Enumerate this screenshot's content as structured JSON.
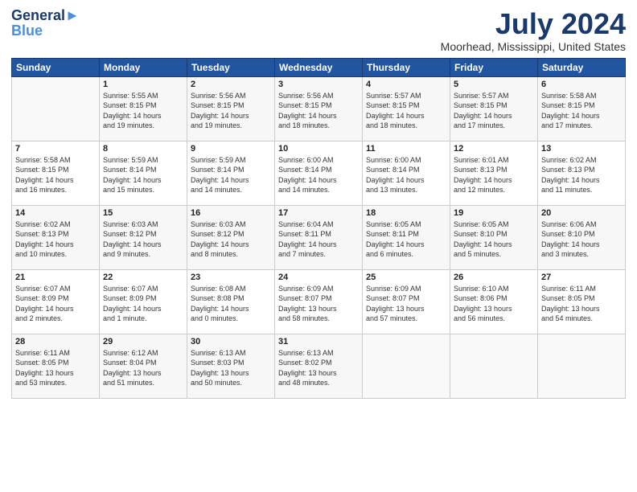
{
  "logo": {
    "line1": "General",
    "line2": "Blue"
  },
  "title": "July 2024",
  "location": "Moorhead, Mississippi, United States",
  "days_of_week": [
    "Sunday",
    "Monday",
    "Tuesday",
    "Wednesday",
    "Thursday",
    "Friday",
    "Saturday"
  ],
  "weeks": [
    [
      {
        "day": "",
        "info": ""
      },
      {
        "day": "1",
        "info": "Sunrise: 5:55 AM\nSunset: 8:15 PM\nDaylight: 14 hours\nand 19 minutes."
      },
      {
        "day": "2",
        "info": "Sunrise: 5:56 AM\nSunset: 8:15 PM\nDaylight: 14 hours\nand 19 minutes."
      },
      {
        "day": "3",
        "info": "Sunrise: 5:56 AM\nSunset: 8:15 PM\nDaylight: 14 hours\nand 18 minutes."
      },
      {
        "day": "4",
        "info": "Sunrise: 5:57 AM\nSunset: 8:15 PM\nDaylight: 14 hours\nand 18 minutes."
      },
      {
        "day": "5",
        "info": "Sunrise: 5:57 AM\nSunset: 8:15 PM\nDaylight: 14 hours\nand 17 minutes."
      },
      {
        "day": "6",
        "info": "Sunrise: 5:58 AM\nSunset: 8:15 PM\nDaylight: 14 hours\nand 17 minutes."
      }
    ],
    [
      {
        "day": "7",
        "info": "Sunrise: 5:58 AM\nSunset: 8:15 PM\nDaylight: 14 hours\nand 16 minutes."
      },
      {
        "day": "8",
        "info": "Sunrise: 5:59 AM\nSunset: 8:14 PM\nDaylight: 14 hours\nand 15 minutes."
      },
      {
        "day": "9",
        "info": "Sunrise: 5:59 AM\nSunset: 8:14 PM\nDaylight: 14 hours\nand 14 minutes."
      },
      {
        "day": "10",
        "info": "Sunrise: 6:00 AM\nSunset: 8:14 PM\nDaylight: 14 hours\nand 14 minutes."
      },
      {
        "day": "11",
        "info": "Sunrise: 6:00 AM\nSunset: 8:14 PM\nDaylight: 14 hours\nand 13 minutes."
      },
      {
        "day": "12",
        "info": "Sunrise: 6:01 AM\nSunset: 8:13 PM\nDaylight: 14 hours\nand 12 minutes."
      },
      {
        "day": "13",
        "info": "Sunrise: 6:02 AM\nSunset: 8:13 PM\nDaylight: 14 hours\nand 11 minutes."
      }
    ],
    [
      {
        "day": "14",
        "info": "Sunrise: 6:02 AM\nSunset: 8:13 PM\nDaylight: 14 hours\nand 10 minutes."
      },
      {
        "day": "15",
        "info": "Sunrise: 6:03 AM\nSunset: 8:12 PM\nDaylight: 14 hours\nand 9 minutes."
      },
      {
        "day": "16",
        "info": "Sunrise: 6:03 AM\nSunset: 8:12 PM\nDaylight: 14 hours\nand 8 minutes."
      },
      {
        "day": "17",
        "info": "Sunrise: 6:04 AM\nSunset: 8:11 PM\nDaylight: 14 hours\nand 7 minutes."
      },
      {
        "day": "18",
        "info": "Sunrise: 6:05 AM\nSunset: 8:11 PM\nDaylight: 14 hours\nand 6 minutes."
      },
      {
        "day": "19",
        "info": "Sunrise: 6:05 AM\nSunset: 8:10 PM\nDaylight: 14 hours\nand 5 minutes."
      },
      {
        "day": "20",
        "info": "Sunrise: 6:06 AM\nSunset: 8:10 PM\nDaylight: 14 hours\nand 3 minutes."
      }
    ],
    [
      {
        "day": "21",
        "info": "Sunrise: 6:07 AM\nSunset: 8:09 PM\nDaylight: 14 hours\nand 2 minutes."
      },
      {
        "day": "22",
        "info": "Sunrise: 6:07 AM\nSunset: 8:09 PM\nDaylight: 14 hours\nand 1 minute."
      },
      {
        "day": "23",
        "info": "Sunrise: 6:08 AM\nSunset: 8:08 PM\nDaylight: 14 hours\nand 0 minutes."
      },
      {
        "day": "24",
        "info": "Sunrise: 6:09 AM\nSunset: 8:07 PM\nDaylight: 13 hours\nand 58 minutes."
      },
      {
        "day": "25",
        "info": "Sunrise: 6:09 AM\nSunset: 8:07 PM\nDaylight: 13 hours\nand 57 minutes."
      },
      {
        "day": "26",
        "info": "Sunrise: 6:10 AM\nSunset: 8:06 PM\nDaylight: 13 hours\nand 56 minutes."
      },
      {
        "day": "27",
        "info": "Sunrise: 6:11 AM\nSunset: 8:05 PM\nDaylight: 13 hours\nand 54 minutes."
      }
    ],
    [
      {
        "day": "28",
        "info": "Sunrise: 6:11 AM\nSunset: 8:05 PM\nDaylight: 13 hours\nand 53 minutes."
      },
      {
        "day": "29",
        "info": "Sunrise: 6:12 AM\nSunset: 8:04 PM\nDaylight: 13 hours\nand 51 minutes."
      },
      {
        "day": "30",
        "info": "Sunrise: 6:13 AM\nSunset: 8:03 PM\nDaylight: 13 hours\nand 50 minutes."
      },
      {
        "day": "31",
        "info": "Sunrise: 6:13 AM\nSunset: 8:02 PM\nDaylight: 13 hours\nand 48 minutes."
      },
      {
        "day": "",
        "info": ""
      },
      {
        "day": "",
        "info": ""
      },
      {
        "day": "",
        "info": ""
      }
    ]
  ]
}
